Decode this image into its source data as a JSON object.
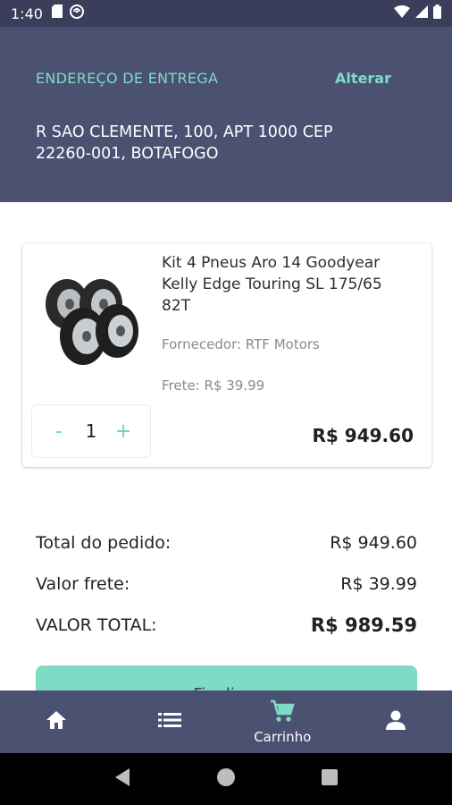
{
  "status_bar": {
    "time": "1:40",
    "left_icons": [
      "sd-card-icon",
      "sync-icon"
    ],
    "right_icons": [
      "wifi-icon",
      "signal-icon",
      "battery-icon"
    ]
  },
  "address": {
    "caption": "ENDEREÇO DE ENTREGA",
    "change_label": "Alterar",
    "line1": "R SAO CLEMENTE, 100, APT 1000 CEP",
    "line2": "22260-001, BOTAFOGO"
  },
  "cart_item": {
    "name": "Kit 4 Pneus Aro 14 Goodyear Kelly Edge Touring SL 175/65 82T",
    "supplier": "Fornecedor: RTF Motors",
    "shipping": "Frete: R$ 39.99",
    "quantity": "1",
    "decrement_label": "-",
    "increment_label": "+",
    "price": "R$ 949.60",
    "image_icon": "tires-image"
  },
  "totals": {
    "order_label": "Total do pedido:",
    "order_value": "R$ 949.60",
    "shipping_label": "Valor frete:",
    "shipping_value": "R$ 39.99",
    "grand_label": "VALOR TOTAL:",
    "grand_value": "R$ 989.59"
  },
  "finalize_button": {
    "label": "Finalizar"
  },
  "bottom_nav": {
    "items": [
      {
        "icon": "home-icon",
        "label": ""
      },
      {
        "icon": "list-icon",
        "label": ""
      },
      {
        "icon": "cart-icon",
        "label": "Carrinho"
      },
      {
        "icon": "person-icon",
        "label": ""
      }
    ],
    "active_index": 2
  },
  "system_nav": {
    "icons": [
      "back-icon",
      "home-circle-icon",
      "recents-icon"
    ]
  },
  "colors": {
    "header_bg": "#4b5171",
    "status_bg": "#3a3e5b",
    "accent": "#7edcc6",
    "nav_bg": "#4b5171"
  }
}
